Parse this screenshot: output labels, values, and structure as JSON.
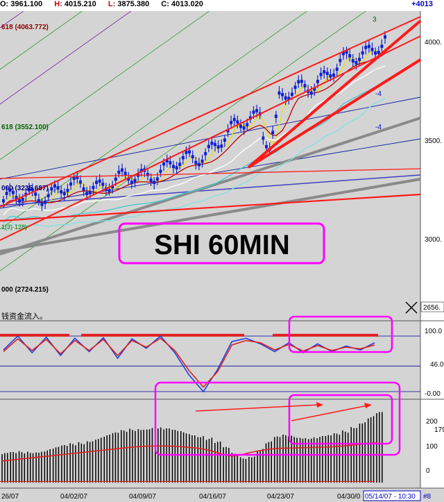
{
  "header": {
    "open_label": "O:",
    "open": "3961.100",
    "high_label": "H:",
    "high": "4015.210",
    "low_label": "L:",
    "low": "3875.380",
    "close_label": "C:",
    "close": "4013.020",
    "right_value": "+4013"
  },
  "main_panel": {
    "banner": "SHI 60MIN",
    "fib_labels": [
      "618 (4063.772)",
      "618 (3552.100)",
      "000 (3235.687)",
      "000 (2724.215)"
    ],
    "partial_label": "1(3)·128)",
    "wave_labels": [
      "3",
      "-4",
      "-4"
    ],
    "price_ticks": [
      "4000.",
      "3500.",
      "3000.",
      "2656."
    ],
    "y_range": [
      2580,
      4130
    ]
  },
  "osc_panel": {
    "caption": "钱资金流入。",
    "ticks": [
      "100.0",
      "46.0",
      "-0.00"
    ],
    "y_range": [
      -5,
      110
    ],
    "fast_color": "#1f3fe0",
    "slow_color": "#e02020"
  },
  "vol_panel": {
    "ticks": [
      "200",
      "179",
      "100",
      "0"
    ],
    "y_range": [
      -40,
      320
    ],
    "bar_color": "#000000",
    "avg_color": "#e02020"
  },
  "x_axis": {
    "dates": [
      "26/07",
      "04/02/07",
      "04/09/07",
      "04/16/07",
      "04/23/07",
      "04/30/0",
      "05/14/07 - 10:30",
      "#8"
    ]
  },
  "chart_data": [
    {
      "type": "line",
      "title": "SHI 60MIN",
      "xlabel": "",
      "ylabel": "",
      "x": [
        "26/07",
        "04/02/07",
        "04/09/07",
        "04/16/07",
        "04/23/07",
        "04/30/0",
        "05/14/07"
      ],
      "series": [
        {
          "values": [
            3180,
            3240,
            3290,
            3390,
            3620,
            3800,
            3990
          ]
        }
      ],
      "ylim": [
        2580,
        4130
      ],
      "grid": false
    },
    {
      "type": "line",
      "xlabel": "",
      "ylabel": "",
      "ylim": [
        -5,
        110
      ],
      "series": [
        {
          "values": [
            75,
            100,
            70,
            98,
            65,
            96,
            72,
            97,
            60,
            95,
            78,
            100,
            70,
            30,
            0,
            40,
            90,
            96,
            86,
            72,
            88,
            70,
            86,
            72,
            82,
            75,
            88
          ]
        },
        {
          "values": [
            72,
            95,
            74,
            94,
            68,
            92,
            74,
            94,
            65,
            92,
            80,
            96,
            74,
            38,
            8,
            36,
            84,
            92,
            88,
            75,
            85,
            73,
            83,
            74,
            80,
            77,
            84
          ]
        }
      ]
    },
    {
      "type": "bar",
      "xlabel": "",
      "ylabel": "",
      "ylim": [
        -40,
        320
      ],
      "values": [
        100,
        104,
        108,
        110,
        112,
        118,
        126,
        134,
        142,
        150,
        160,
        170,
        180,
        190,
        200,
        208,
        212,
        214,
        212,
        208,
        202,
        196,
        188,
        180,
        168,
        150,
        126,
        100,
        85,
        92,
        120,
        150,
        172,
        180,
        178,
        174,
        172,
        174,
        178,
        186,
        200,
        220,
        240,
        262,
        280
      ],
      "series": [
        {
          "values": [
            70,
            74,
            78,
            82,
            86,
            90,
            94,
            98,
            102,
            106,
            110,
            114,
            118,
            122,
            126,
            130,
            133,
            135,
            136,
            136,
            135,
            133,
            130,
            126,
            120,
            110,
            98,
            92,
            96,
            106,
            114,
            120,
            124,
            126,
            127,
            128,
            129,
            130,
            131,
            133,
            136,
            139,
            143,
            147,
            151
          ]
        }
      ]
    }
  ]
}
